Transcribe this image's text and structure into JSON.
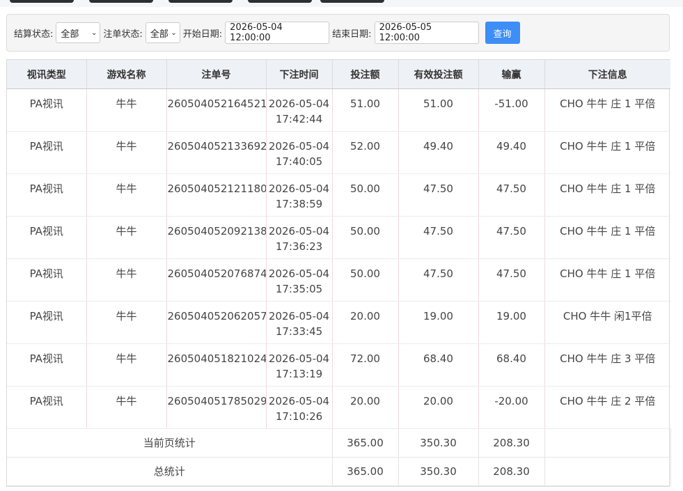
{
  "filters": {
    "settle_status_label": "结算状态:",
    "settle_status_value": "全部",
    "order_status_label": "注单状态:",
    "order_status_value": "全部",
    "start_date_label": "开始日期:",
    "start_date_value": "2026-05-04 12:00:00",
    "end_date_label": "结束日期:",
    "end_date_value": "2026-05-05 12:00:00",
    "query_button": "查询"
  },
  "table": {
    "headers": [
      "视讯类型",
      "游戏名称",
      "注单号",
      "下注时间",
      "投注额",
      "有效投注额",
      "输赢",
      "下注信息"
    ],
    "rows": [
      {
        "type": "PA视讯",
        "game": "牛牛",
        "order_no": "260504052164521",
        "date": "2026-05-04",
        "time": "17:42:44",
        "bet": "51.00",
        "valid_bet": "51.00",
        "win_loss": "-51.00",
        "info": "CHO 牛牛 庄 1 平倍"
      },
      {
        "type": "PA视讯",
        "game": "牛牛",
        "order_no": "260504052133692",
        "date": "2026-05-04",
        "time": "17:40:05",
        "bet": "52.00",
        "valid_bet": "49.40",
        "win_loss": "49.40",
        "info": "CHO 牛牛 庄 1 平倍"
      },
      {
        "type": "PA视讯",
        "game": "牛牛",
        "order_no": "260504052121180",
        "date": "2026-05-04",
        "time": "17:38:59",
        "bet": "50.00",
        "valid_bet": "47.50",
        "win_loss": "47.50",
        "info": "CHO 牛牛 庄 1 平倍"
      },
      {
        "type": "PA视讯",
        "game": "牛牛",
        "order_no": "260504052092138",
        "date": "2026-05-04",
        "time": "17:36:23",
        "bet": "50.00",
        "valid_bet": "47.50",
        "win_loss": "47.50",
        "info": "CHO 牛牛 庄 1 平倍"
      },
      {
        "type": "PA视讯",
        "game": "牛牛",
        "order_no": "260504052076874",
        "date": "2026-05-04",
        "time": "17:35:05",
        "bet": "50.00",
        "valid_bet": "47.50",
        "win_loss": "47.50",
        "info": "CHO 牛牛 庄 1 平倍"
      },
      {
        "type": "PA视讯",
        "game": "牛牛",
        "order_no": "260504052062057",
        "date": "2026-05-04",
        "time": "17:33:45",
        "bet": "20.00",
        "valid_bet": "19.00",
        "win_loss": "19.00",
        "info": "CHO 牛牛 闲1平倍"
      },
      {
        "type": "PA视讯",
        "game": "牛牛",
        "order_no": "260504051821024",
        "date": "2026-05-04",
        "time": "17:13:19",
        "bet": "72.00",
        "valid_bet": "68.40",
        "win_loss": "68.40",
        "info": "CHO 牛牛 庄 3 平倍"
      },
      {
        "type": "PA视讯",
        "game": "牛牛",
        "order_no": "260504051785029",
        "date": "2026-05-04",
        "time": "17:10:26",
        "bet": "20.00",
        "valid_bet": "20.00",
        "win_loss": "-20.00",
        "info": "CHO 牛牛 庄 2 平倍"
      }
    ],
    "page_summary": {
      "label": "当前页统计",
      "bet": "365.00",
      "valid_bet": "350.30",
      "win_loss": "208.30"
    },
    "total_summary": {
      "label": "总统计",
      "bet": "365.00",
      "valid_bet": "350.30",
      "win_loss": "208.30"
    }
  }
}
